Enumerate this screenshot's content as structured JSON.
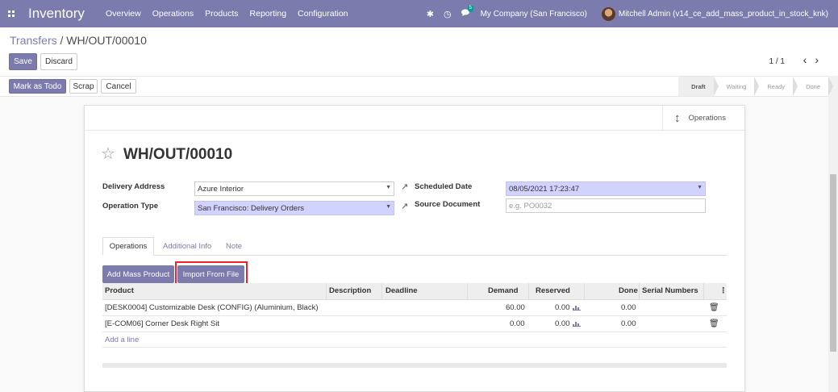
{
  "navbar": {
    "brand": "Inventory",
    "menu": [
      "Overview",
      "Operations",
      "Products",
      "Reporting",
      "Configuration"
    ],
    "chat_badge": "5",
    "company": "My Company (San Francisco)",
    "user": "Mitchell Admin (v14_ce_add_mass_product_in_stock_knk)"
  },
  "breadcrumb": {
    "parent": "Transfers",
    "separator": " / ",
    "current": "WH/OUT/00010"
  },
  "buttons": {
    "save": "Save",
    "discard": "Discard",
    "mark_as_todo": "Mark as Todo",
    "scrap": "Scrap",
    "cancel": "Cancel"
  },
  "pager": {
    "value": "1 / 1"
  },
  "stages": [
    "Draft",
    "Waiting",
    "Ready",
    "Done"
  ],
  "active_stage": "Draft",
  "smart_button": {
    "label": "Operations"
  },
  "record": {
    "name": "WH/OUT/00010",
    "delivery_address_label": "Delivery Address",
    "delivery_address": "Azure Interior",
    "operation_type_label": "Operation Type",
    "operation_type": "San Francisco: Delivery Orders",
    "scheduled_date_label": "Scheduled Date",
    "scheduled_date": "08/05/2021 17:23:47",
    "source_document_label": "Source Document",
    "source_document_placeholder": "e.g. PO0032"
  },
  "tabs": [
    "Operations",
    "Additional Info",
    "Note"
  ],
  "actions": {
    "add_mass_product": "Add Mass Product",
    "import_from_file": "Import From File"
  },
  "table": {
    "headers": {
      "product": "Product",
      "description": "Description",
      "deadline": "Deadline",
      "demand": "Demand",
      "reserved": "Reserved",
      "done": "Done",
      "serial_numbers": "Serial Numbers"
    },
    "rows": [
      {
        "product": "[DESK0004] Customizable Desk (CONFIG) (Aluminium, Black)",
        "demand": "60.00",
        "reserved": "0.00",
        "done": "0.00"
      },
      {
        "product": "[E-COM06] Corner Desk Right Sit",
        "demand": "0.00",
        "reserved": "0.00",
        "done": "0.00"
      }
    ],
    "add_line": "Add a line"
  },
  "colors": {
    "brand": "#7C7BAD",
    "required_field": "#D2D2FF",
    "highlight": "#EE2222"
  }
}
